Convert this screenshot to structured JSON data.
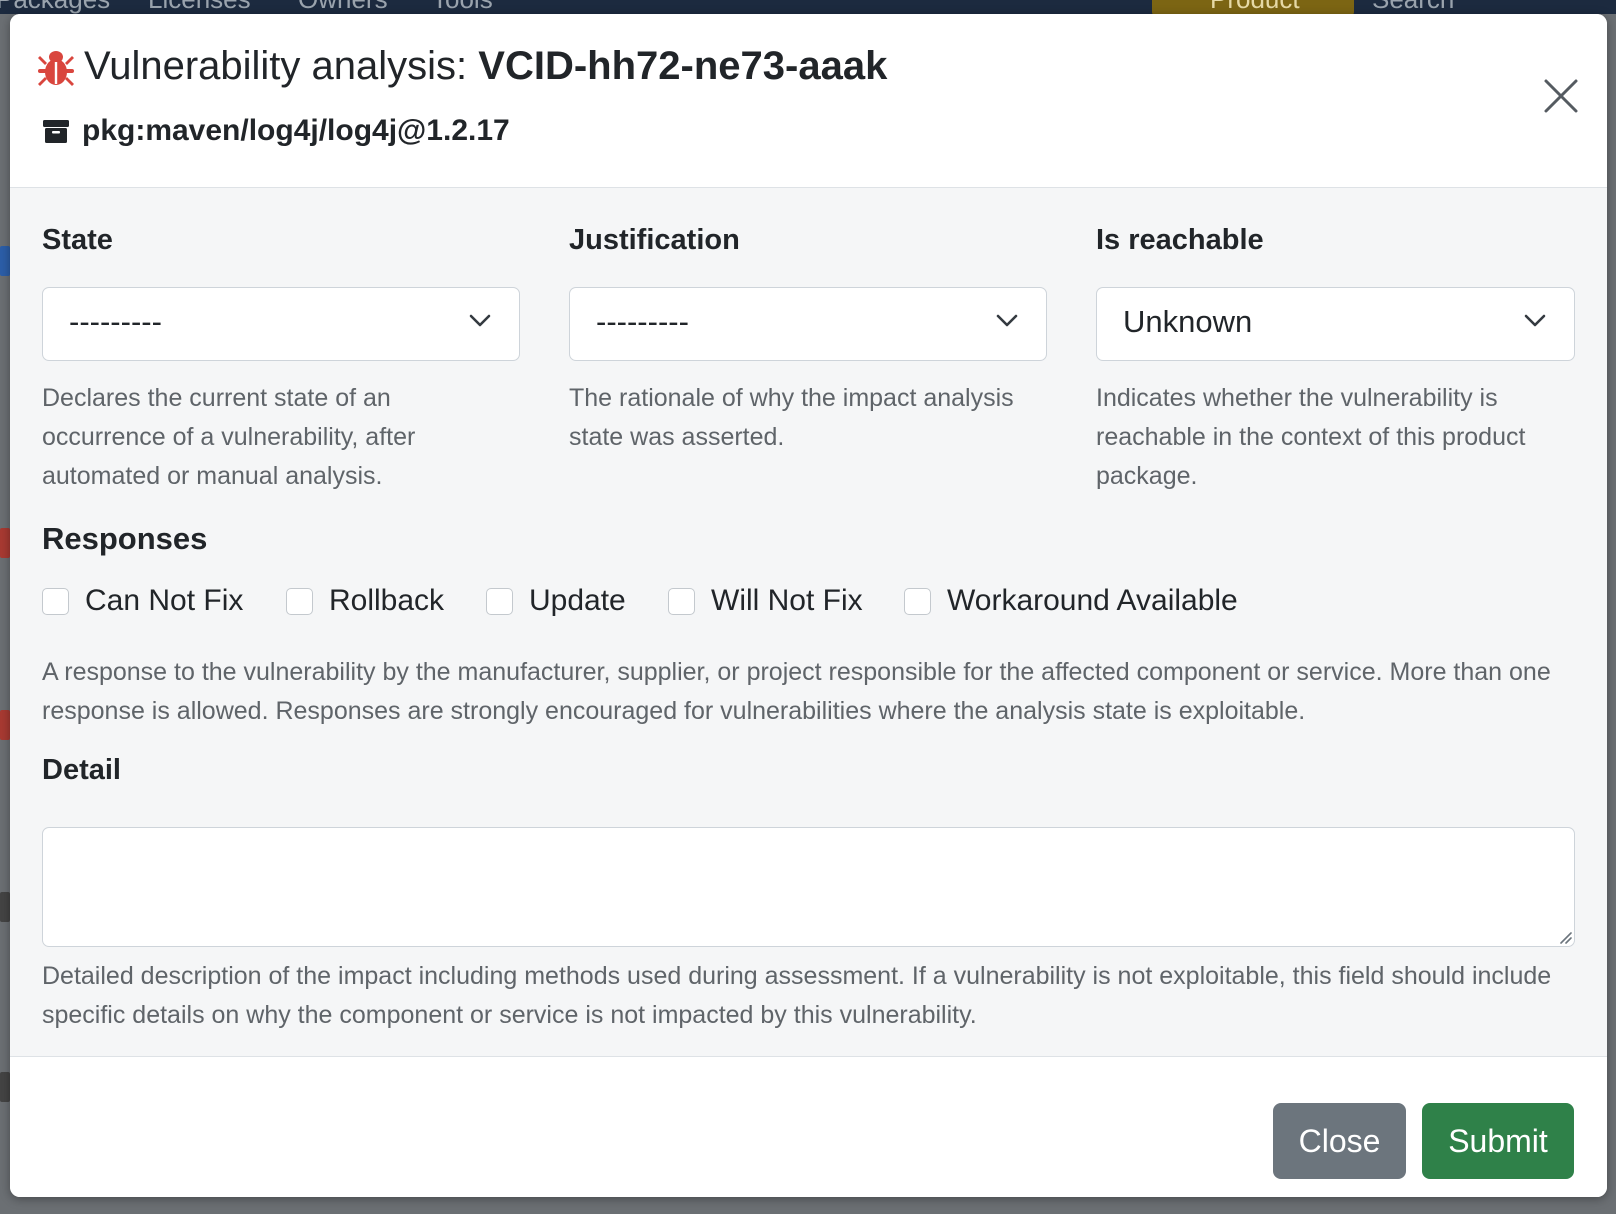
{
  "background": {
    "nav_items": [
      "Packages",
      "Licenses",
      "Owners",
      "Tools"
    ],
    "product_menu": "Product",
    "search_link": "Search"
  },
  "modal": {
    "title_prefix": "Vulnerability analysis:",
    "title_id": "VCID-hh72-ne73-aaak",
    "package_url": "pkg:maven/log4j/log4j@1.2.17",
    "colors": {
      "bug_icon": "#d9463e",
      "submit": "#2f8149",
      "close": "#6c757d"
    }
  },
  "fields": {
    "state": {
      "label": "State",
      "value": "---------",
      "help": "Declares the current state of an occurrence of a vulnerability, after automated or manual analysis."
    },
    "justification": {
      "label": "Justification",
      "value": "---------",
      "help": "The rationale of why the impact analysis state was asserted."
    },
    "reachable": {
      "label": "Is reachable",
      "value": "Unknown",
      "help": "Indicates whether the vulnerability is reachable in the context of this product package."
    }
  },
  "responses": {
    "label": "Responses",
    "options": [
      "Can Not Fix",
      "Rollback",
      "Update",
      "Will Not Fix",
      "Workaround Available"
    ],
    "help": "A response to the vulnerability by the manufacturer, supplier, or project responsible for the affected component or service. More than one response is allowed. Responses are strongly encouraged for vulnerabilities where the analysis state is exploitable."
  },
  "detail": {
    "label": "Detail",
    "value": "",
    "help": "Detailed description of the impact including methods used during assessment. If a vulnerability is not exploitable, this field should include specific details on why the component or service is not impacted by this vulnerability."
  },
  "footer": {
    "close_label": "Close",
    "submit_label": "Submit"
  }
}
